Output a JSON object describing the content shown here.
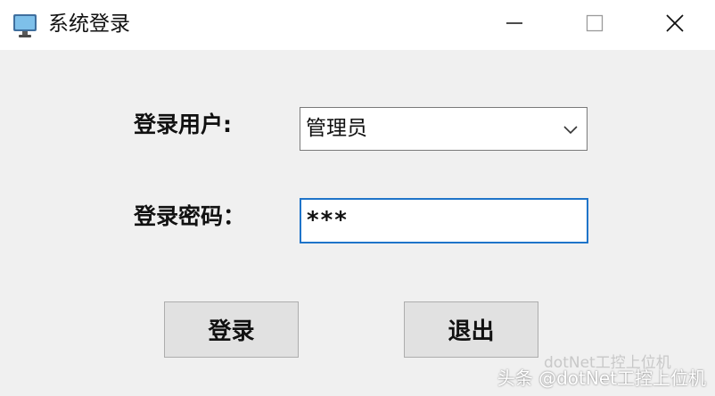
{
  "window": {
    "title": "系统登录",
    "icon": "computer-monitor-icon",
    "controls": [
      "minimize-icon",
      "maximize-icon",
      "close-icon"
    ]
  },
  "form": {
    "user_label": "登录用户:",
    "user_selected": "管理员",
    "password_label": "登录密码：",
    "password_value": "***"
  },
  "buttons": {
    "login": "登录",
    "exit": "退出"
  },
  "watermark": {
    "text": "头条 @dotNet工控上位机",
    "faint_text": "dotNet工控上位机"
  },
  "colors": {
    "titlebar": "#ffffff",
    "client": "#f0f0f0",
    "focus_border": "#1f74c9"
  }
}
